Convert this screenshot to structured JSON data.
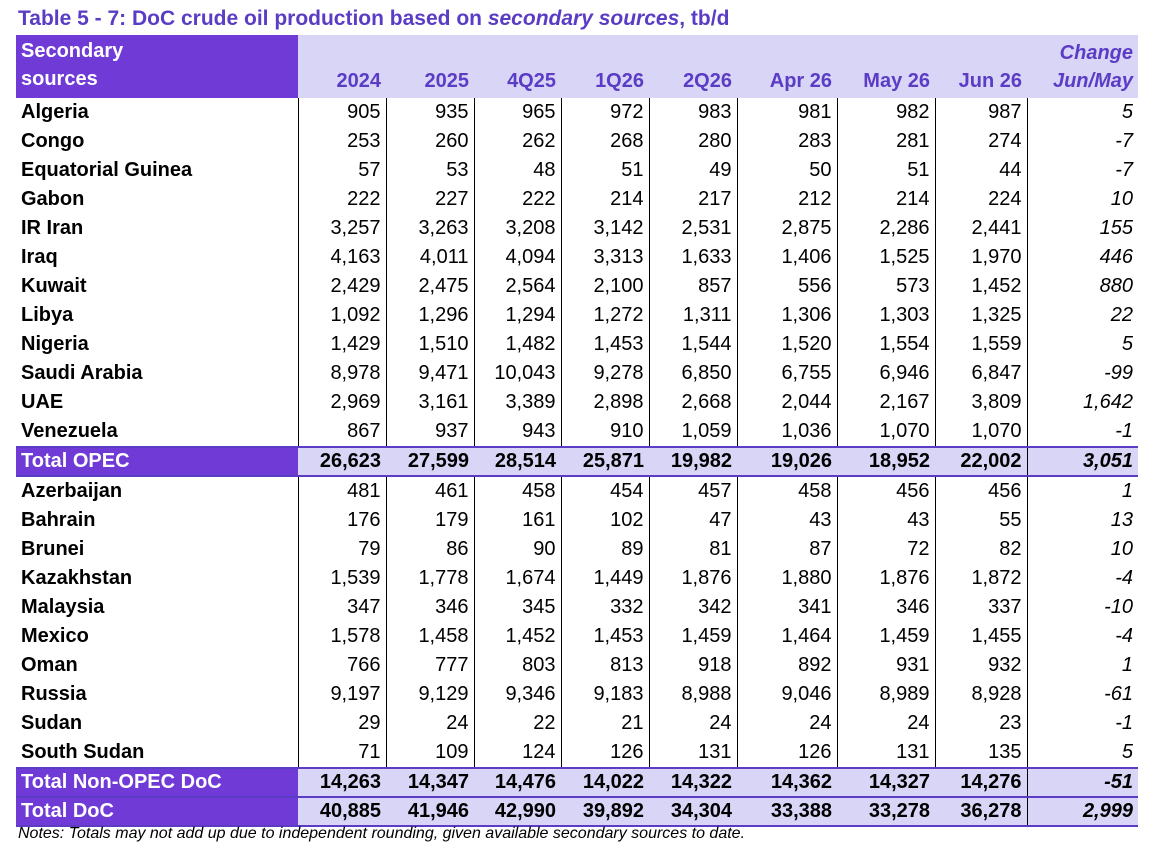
{
  "title": {
    "prefix": "Table 5 - 7: DoC crude oil production based on ",
    "italic": "secondary sources",
    "suffix": ", tb/d"
  },
  "header": {
    "source_label_line1": "Secondary",
    "source_label_line2": "sources",
    "columns": [
      "2024",
      "2025",
      "4Q25",
      "1Q26",
      "2Q26",
      "Apr 26",
      "May 26",
      "Jun 26"
    ],
    "change_line1": "Change",
    "change_line2": "Jun/May"
  },
  "rows": [
    {
      "name": "Algeria",
      "values": [
        "905",
        "935",
        "965",
        "972",
        "983",
        "981",
        "982",
        "987"
      ],
      "change": "5",
      "total": false
    },
    {
      "name": "Congo",
      "values": [
        "253",
        "260",
        "262",
        "268",
        "280",
        "283",
        "281",
        "274"
      ],
      "change": "-7",
      "total": false
    },
    {
      "name": "Equatorial Guinea",
      "values": [
        "57",
        "53",
        "48",
        "51",
        "49",
        "50",
        "51",
        "44"
      ],
      "change": "-7",
      "total": false
    },
    {
      "name": "Gabon",
      "values": [
        "222",
        "227",
        "222",
        "214",
        "217",
        "212",
        "214",
        "224"
      ],
      "change": "10",
      "total": false
    },
    {
      "name": "IR Iran",
      "values": [
        "3,257",
        "3,263",
        "3,208",
        "3,142",
        "2,531",
        "2,875",
        "2,286",
        "2,441"
      ],
      "change": "155",
      "total": false
    },
    {
      "name": "Iraq",
      "values": [
        "4,163",
        "4,011",
        "4,094",
        "3,313",
        "1,633",
        "1,406",
        "1,525",
        "1,970"
      ],
      "change": "446",
      "total": false
    },
    {
      "name": "Kuwait",
      "values": [
        "2,429",
        "2,475",
        "2,564",
        "2,100",
        "857",
        "556",
        "573",
        "1,452"
      ],
      "change": "880",
      "total": false
    },
    {
      "name": "Libya",
      "values": [
        "1,092",
        "1,296",
        "1,294",
        "1,272",
        "1,311",
        "1,306",
        "1,303",
        "1,325"
      ],
      "change": "22",
      "total": false
    },
    {
      "name": "Nigeria",
      "values": [
        "1,429",
        "1,510",
        "1,482",
        "1,453",
        "1,544",
        "1,520",
        "1,554",
        "1,559"
      ],
      "change": "5",
      "total": false
    },
    {
      "name": "Saudi Arabia",
      "values": [
        "8,978",
        "9,471",
        "10,043",
        "9,278",
        "6,850",
        "6,755",
        "6,946",
        "6,847"
      ],
      "change": "-99",
      "total": false
    },
    {
      "name": "UAE",
      "values": [
        "2,969",
        "3,161",
        "3,389",
        "2,898",
        "2,668",
        "2,044",
        "2,167",
        "3,809"
      ],
      "change": "1,642",
      "total": false
    },
    {
      "name": "Venezuela",
      "values": [
        "867",
        "937",
        "943",
        "910",
        "1,059",
        "1,036",
        "1,070",
        "1,070"
      ],
      "change": "-1",
      "total": false
    },
    {
      "name": "Total  OPEC",
      "values": [
        "26,623",
        "27,599",
        "28,514",
        "25,871",
        "19,982",
        "19,026",
        "18,952",
        "22,002"
      ],
      "change": "3,051",
      "total": true
    },
    {
      "name": "Azerbaijan",
      "values": [
        "481",
        "461",
        "458",
        "454",
        "457",
        "458",
        "456",
        "456"
      ],
      "change": "1",
      "total": false
    },
    {
      "name": "Bahrain",
      "values": [
        "176",
        "179",
        "161",
        "102",
        "47",
        "43",
        "43",
        "55"
      ],
      "change": "13",
      "total": false
    },
    {
      "name": "Brunei",
      "values": [
        "79",
        "86",
        "90",
        "89",
        "81",
        "87",
        "72",
        "82"
      ],
      "change": "10",
      "total": false
    },
    {
      "name": "Kazakhstan",
      "values": [
        "1,539",
        "1,778",
        "1,674",
        "1,449",
        "1,876",
        "1,880",
        "1,876",
        "1,872"
      ],
      "change": "-4",
      "total": false
    },
    {
      "name": "Malaysia",
      "values": [
        "347",
        "346",
        "345",
        "332",
        "342",
        "341",
        "346",
        "337"
      ],
      "change": "-10",
      "total": false
    },
    {
      "name": "Mexico",
      "values": [
        "1,578",
        "1,458",
        "1,452",
        "1,453",
        "1,459",
        "1,464",
        "1,459",
        "1,455"
      ],
      "change": "-4",
      "total": false
    },
    {
      "name": "Oman",
      "values": [
        "766",
        "777",
        "803",
        "813",
        "918",
        "892",
        "931",
        "932"
      ],
      "change": "1",
      "total": false
    },
    {
      "name": "Russia",
      "values": [
        "9,197",
        "9,129",
        "9,346",
        "9,183",
        "8,988",
        "9,046",
        "8,989",
        "8,928"
      ],
      "change": "-61",
      "total": false
    },
    {
      "name": "Sudan",
      "values": [
        "29",
        "24",
        "22",
        "21",
        "24",
        "24",
        "24",
        "23"
      ],
      "change": "-1",
      "total": false
    },
    {
      "name": "South Sudan",
      "values": [
        "71",
        "109",
        "124",
        "126",
        "131",
        "126",
        "131",
        "135"
      ],
      "change": "5",
      "total": false
    },
    {
      "name": "Total Non-OPEC DoC",
      "values": [
        "14,263",
        "14,347",
        "14,476",
        "14,022",
        "14,322",
        "14,362",
        "14,327",
        "14,276"
      ],
      "change": "-51",
      "total": true
    },
    {
      "name": "Total DoC",
      "values": [
        "40,885",
        "41,946",
        "42,990",
        "39,892",
        "34,304",
        "33,388",
        "33,278",
        "36,278"
      ],
      "change": "2,999",
      "total": true
    }
  ],
  "notes": "Notes: Totals may not add up due to independent rounding, given available secondary sources to date.",
  "colors": {
    "accent": "#6f3ad6",
    "header_bg": "#d9d5f7",
    "title": "#5b3cc4"
  }
}
